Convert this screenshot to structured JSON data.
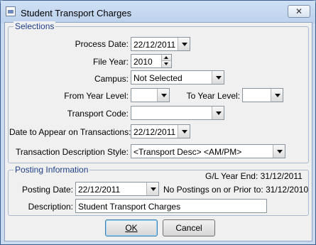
{
  "window": {
    "title": "Student Transport Charges",
    "close_label": "✕"
  },
  "selections": {
    "legend": "Selections",
    "process_date": {
      "label": "Process Date:",
      "value": "22/12/2011"
    },
    "file_year": {
      "label": "File Year:",
      "value": "2010"
    },
    "campus": {
      "label": "Campus:",
      "value": "Not Selected"
    },
    "from_year_level": {
      "label": "From Year Level:",
      "value": ""
    },
    "to_year_level": {
      "label": "To Year Level:",
      "value": ""
    },
    "transport_code": {
      "label": "Transport Code:",
      "value": ""
    },
    "date_to_appear": {
      "label": "Date to Appear on Transactions:",
      "value": "22/12/2011"
    },
    "desc_style": {
      "label": "Transaction Description Style:",
      "value": "<Transport Desc> <AM/PM>"
    }
  },
  "posting": {
    "legend": "Posting Information",
    "gl_year_end": "G/L Year End: 31/12/2011",
    "posting_date": {
      "label": "Posting Date:",
      "value": "22/12/2011"
    },
    "no_postings_note": "No Postings on or Prior to: 31/12/2010",
    "description": {
      "label": "Description:",
      "value": "Student Transport Charges"
    }
  },
  "buttons": {
    "ok": "OK",
    "cancel": "Cancel"
  }
}
